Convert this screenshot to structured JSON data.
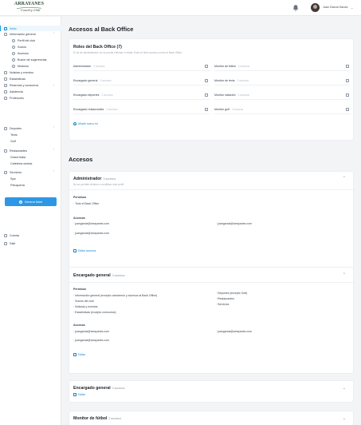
{
  "header": {
    "logo_word": "ARRAYANES",
    "logo_script": "Country Club",
    "user_name": "Juan García García"
  },
  "sidebar": {
    "items": [
      {
        "label": "Inicio",
        "icon": "home-icon",
        "active": true
      },
      {
        "label": "Información general",
        "icon": "info-icon",
        "expandable": true
      },
      {
        "label": "Perfil del club",
        "icon": "circle-icon",
        "sub": true
      },
      {
        "label": "Socios",
        "icon": "users-icon",
        "sub": true
      },
      {
        "label": "Accesos",
        "icon": "key-icon",
        "sub": true
      },
      {
        "label": "Buzón de sugerencias",
        "icon": "mailbox-icon",
        "sub": true
      },
      {
        "label": "Módulos",
        "icon": "grid-icon",
        "sub": true
      },
      {
        "label": "Noticias y eventos",
        "icon": "news-icon"
      },
      {
        "label": "Estadísticas",
        "icon": "stats-icon"
      },
      {
        "label": "Reservas y consumos",
        "icon": "calendar-icon",
        "expandable": true
      },
      {
        "label": "Asistencia",
        "icon": "support-icon"
      },
      {
        "label": "Profesores",
        "icon": "teacher-icon"
      },
      {
        "label": "Deportes",
        "icon": "sports-icon",
        "expandable": true
      },
      {
        "label": "Tenis",
        "plain": true
      },
      {
        "label": "Golf",
        "plain": true
      },
      {
        "label": "Restaurantes",
        "icon": "restaurant-icon",
        "expandable": true
      },
      {
        "label": "Grand Italia",
        "plain": true
      },
      {
        "label": "Cafetería central",
        "plain": true
      },
      {
        "label": "Servicios",
        "icon": "services-icon",
        "expandable": true
      },
      {
        "label": "Spa",
        "plain": true
      },
      {
        "label": "Peluquería",
        "plain": true
      }
    ],
    "generate_button": "Generar ticket",
    "bottom": [
      {
        "label": "Cuenta",
        "icon": "account-icon"
      },
      {
        "label": "Salir",
        "icon": "logout-icon"
      }
    ]
  },
  "main": {
    "title_backoffice": "Accesos al Back Office",
    "roles_card": {
      "title": "Roles del Back Office (7)",
      "subtitle": "El rol de administrador no se puede eliminar ni editar. Este rol tiene acceso a todo el Back Office.",
      "left_roles": [
        {
          "name": "Administrador",
          "count": "2 accesos"
        },
        {
          "name": "Encargado general",
          "count": "3 accesos"
        },
        {
          "name": "Encargado deportes",
          "count": "2 accesos"
        },
        {
          "name": "Encargado restaurantes",
          "count": "3 accesos"
        }
      ],
      "right_roles": [
        {
          "name": "Monitor de fútbol",
          "count": "4 accesos"
        },
        {
          "name": "Monitor de tenis",
          "count": "2 accesos"
        },
        {
          "name": "Monitor natación",
          "count": "2 accesos"
        },
        {
          "name": "Monitor golf",
          "count": "2 accesos"
        }
      ],
      "add_role": "Añadir nuevo rol"
    },
    "title_access": "Accesos",
    "admin_card": {
      "title": "Administrador",
      "count": "3 accesos",
      "subtitle": "No se permite eliminar o modificar este perfil",
      "permisos_label": "Permisos",
      "permisos": [
        "Todo el Back Office"
      ],
      "accesos_label": "Accesos",
      "accesos_left": [
        "juangarcia@arrayanes.com",
        "juangarcia@arrayanes.com"
      ],
      "accesos_right": [
        "juangarcia@arrayanes.com"
      ],
      "edit": "Editar accesos"
    },
    "encargado_card": {
      "title": "Encargado general",
      "count": "3 accesos",
      "permisos_label": "Permisos",
      "permisos_left": [
        "Información general (excepto camareros y accesos al Back Office)",
        "Socios del club",
        "Noticias y eventos",
        "Estadísticas (excepto consumos)"
      ],
      "permisos_right": [
        "Deportes (excepto Golf)",
        "Restaurantes",
        "Servicios"
      ],
      "accesos_label": "Accesos",
      "accesos_left": [
        "juangarcia@arrayanes.com",
        "juangarcia@arrayanes.com"
      ],
      "accesos_right": [
        "juangarcia@arrayanes.com"
      ],
      "edit": "Editar"
    },
    "collapsed_card": {
      "title": "Encargado general",
      "count": "3 accesos",
      "edit": "Editar"
    },
    "monitor_card": {
      "title": "Monitor de fútbol",
      "count": "2 accesos"
    }
  },
  "colors": {
    "accent": "#1b86c9",
    "button": "#2e97e5",
    "active_bg": "#edf7fd"
  }
}
